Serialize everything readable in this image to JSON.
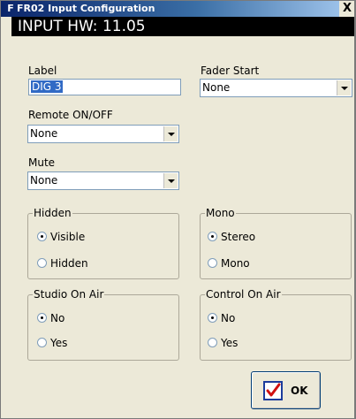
{
  "window": {
    "title_icon": "F",
    "title": "FR02 Input Configuration",
    "close_label": "X"
  },
  "header": {
    "text": "INPUT HW: 11.05"
  },
  "label_field": {
    "label": "Label",
    "value": "DIG 3"
  },
  "fader_start": {
    "label": "Fader Start",
    "value": "None"
  },
  "remote": {
    "label": "Remote ON/OFF",
    "value": "None"
  },
  "mute": {
    "label": "Mute",
    "value": "None"
  },
  "hidden_group": {
    "legend": "Hidden",
    "options": [
      {
        "label": "Visible",
        "checked": true
      },
      {
        "label": "Hidden",
        "checked": false
      }
    ]
  },
  "mono_group": {
    "legend": "Mono",
    "options": [
      {
        "label": "Stereo",
        "checked": true
      },
      {
        "label": "Mono",
        "checked": false
      }
    ]
  },
  "studio_group": {
    "legend": "Studio On Air",
    "options": [
      {
        "label": "No",
        "checked": true
      },
      {
        "label": "Yes",
        "checked": false
      }
    ]
  },
  "control_group": {
    "legend": "Control On Air",
    "options": [
      {
        "label": "No",
        "checked": true
      },
      {
        "label": "Yes",
        "checked": false
      }
    ]
  },
  "ok_button": {
    "label": "OK",
    "icon": "checkbox-check-icon"
  },
  "colors": {
    "titlebar": "#0a246a",
    "header_band": "#000000",
    "dialog_bg": "#ece9d8",
    "selection": "#316ac5"
  }
}
